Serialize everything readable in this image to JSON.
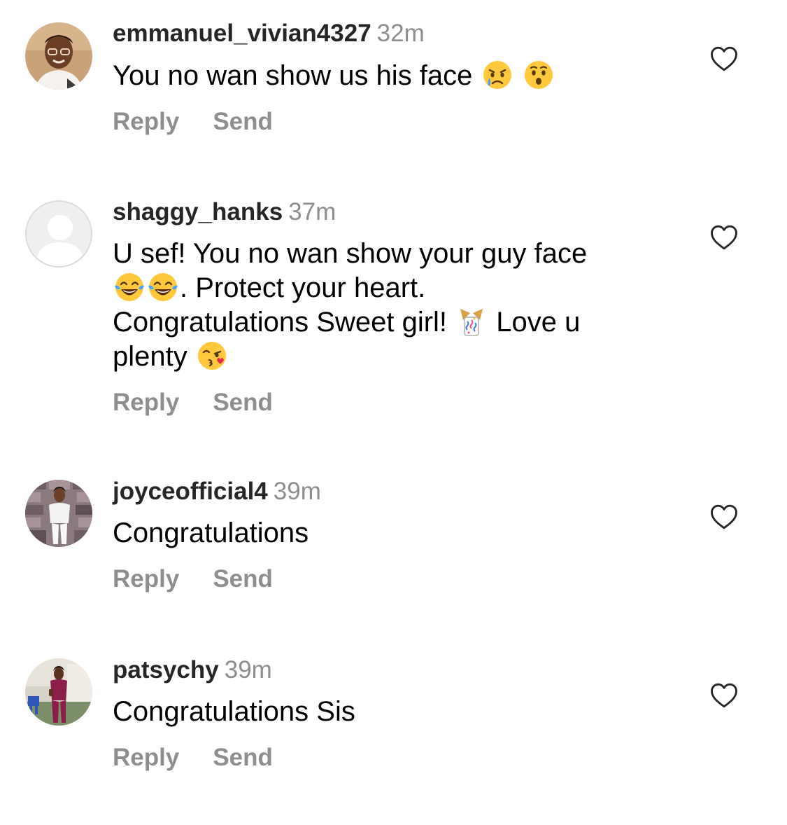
{
  "comments": [
    {
      "username": "emmanuel_vivian4327",
      "time": "32m",
      "text_parts": [
        "You no wan show us his face "
      ],
      "emojis": [
        "crying-face",
        "hushed-face"
      ],
      "reply_label": "Reply",
      "send_label": "Send"
    },
    {
      "username": "shaggy_hanks",
      "time": "37m",
      "line1": "U sef! You no wan show your guy face",
      "line2_after_emoji": ". Protect your heart.",
      "line3_before_emoji": "Congratulations Sweet girl! ",
      "line3_after_emoji": " Love u",
      "line4": "plenty ",
      "emojis": [
        "tears-of-joy-face",
        "tears-of-joy-face",
        "party-popper",
        "face-blowing-kiss"
      ],
      "reply_label": "Reply",
      "send_label": "Send"
    },
    {
      "username": "joyceofficial4",
      "time": "39m",
      "text": "Congratulations",
      "reply_label": "Reply",
      "send_label": "Send"
    },
    {
      "username": "patsychy",
      "time": "39m",
      "text": "Congratulations Sis",
      "reply_label": "Reply",
      "send_label": "Send"
    }
  ],
  "colors": {
    "username": "#262626",
    "secondary": "#8e8e8e",
    "text": "#000000",
    "background": "#ffffff"
  },
  "icons": {
    "like": "heart-outline-icon",
    "default_avatar": "default-avatar-icon"
  }
}
